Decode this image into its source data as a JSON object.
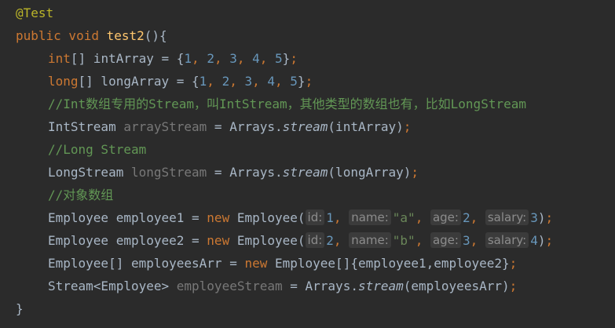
{
  "code": {
    "l1": {
      "ann": "@Test"
    },
    "l2": {
      "kw": "public void ",
      "fn": "test2",
      "rest": "(){"
    },
    "l3": {
      "kw": "int",
      "a": "[] intArray = {",
      "n1": "1",
      "c1": ", ",
      "n2": "2",
      "c2": ", ",
      "n3": "3",
      "c3": ", ",
      "n4": "4",
      "c4": ", ",
      "n5": "5",
      "b": "}",
      "semi": ";"
    },
    "l4": {
      "kw": "long",
      "a": "[] longArray = {",
      "n1": "1",
      "c1": ", ",
      "n2": "2",
      "c2": ", ",
      "n3": "3",
      "c3": ", ",
      "n4": "4",
      "c4": ", ",
      "n5": "5",
      "b": "}",
      "semi": ";"
    },
    "l5": {
      "cmt": "//Int数组专用的Stream，叫IntStream，其他类型的数组也有，比如LongStream"
    },
    "l6": {
      "a": "IntStream ",
      "var": "arrayStream",
      "b": " = Arrays.",
      "m": "stream",
      "c": "(intArray)",
      "semi": ";"
    },
    "l7": {
      "cmt": "//Long Stream"
    },
    "l8": {
      "a": "LongStream ",
      "var": "longStream",
      "b": " = Arrays.",
      "m": "stream",
      "c": "(longArray)",
      "semi": ";"
    },
    "l9": {
      "cmt": "//对象数组"
    },
    "l10": {
      "a": "Employee employee1 = ",
      "kw": "new",
      "b": " Employee(",
      "h1": "id:",
      "v1": "1",
      "s1": ", ",
      "h2": "name:",
      "v2": "\"a\"",
      "s2": ", ",
      "h3": "age:",
      "v3": "2",
      "s3": ", ",
      "h4": "salary:",
      "v4": "3",
      "end": ")",
      "semi": ";"
    },
    "l11": {
      "a": "Employee employee2 = ",
      "kw": "new",
      "b": " Employee(",
      "h1": "id:",
      "v1": "2",
      "s1": ", ",
      "h2": "name:",
      "v2": "\"b\"",
      "s2": ", ",
      "h3": "age:",
      "v3": "3",
      "s3": ", ",
      "h4": "salary:",
      "v4": "4",
      "end": ")",
      "semi": ";"
    },
    "l12": {
      "a": "Employee[] employeesArr = ",
      "kw": "new",
      "b": " Employee[]{employee1,employee2}",
      "semi": ";"
    },
    "l13": {
      "a": "Stream<Employee> ",
      "var": "employeeStream",
      "b": " = Arrays.",
      "m": "stream",
      "c": "(employeesArr)",
      "semi": ";"
    },
    "l14": {
      "brace": "}"
    }
  }
}
